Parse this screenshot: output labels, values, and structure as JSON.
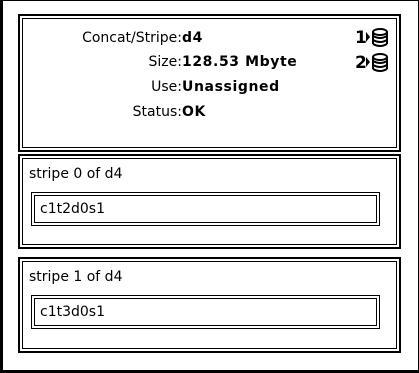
{
  "metadevice": {
    "type_label": "Concat/Stripe:",
    "name": "d4",
    "size_label": "Size:",
    "size": "128.53 Mbyte",
    "use_label": "Use:",
    "use": "Unassigned",
    "status_label": "Status:",
    "status": "OK"
  },
  "stripe_icons": [
    {
      "number": "1",
      "icon": "disk-stack-icon"
    },
    {
      "number": "2",
      "icon": "disk-stack-icon"
    }
  ],
  "stripes": [
    {
      "title": "stripe 0 of d4",
      "component": "c1t2d0s1"
    },
    {
      "title": "stripe 1 of d4",
      "component": "c1t3d0s1"
    }
  ]
}
